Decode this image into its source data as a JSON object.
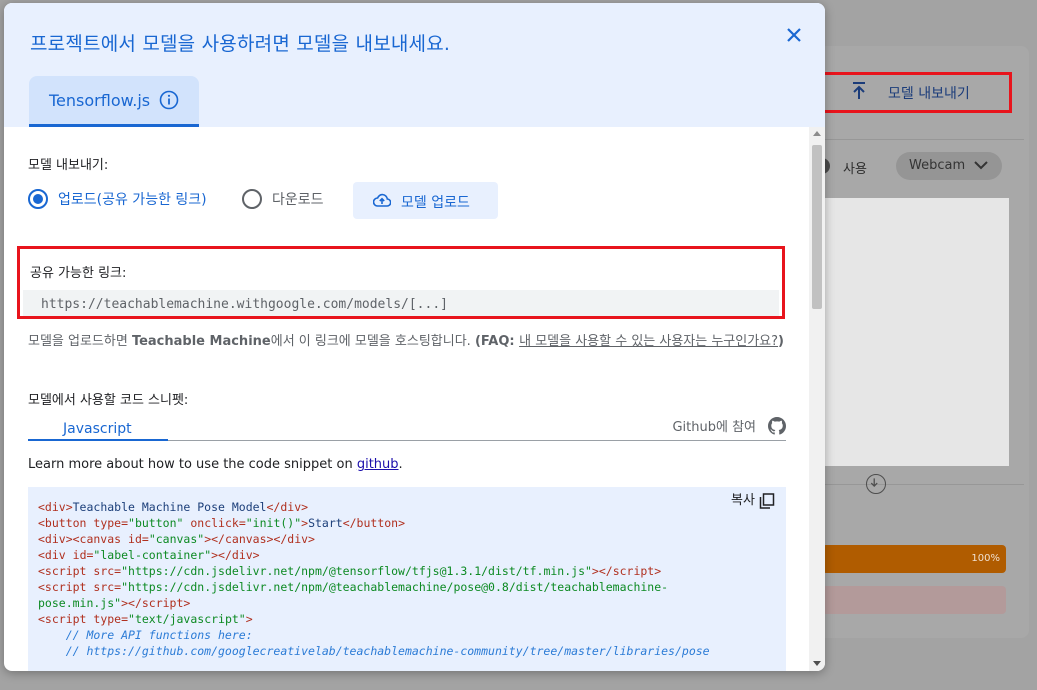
{
  "background": {
    "export_button_label": "모델 내보내기",
    "use_label": "사용",
    "webcam_label": "Webcam",
    "progress_pct": "100%"
  },
  "modal": {
    "title": "프로젝트에서 모델을 사용하려면 모델을 내보내세요.",
    "tab_label": "Tensorflow.js",
    "export_section_label": "모델 내보내기:",
    "radio_upload_label": "업로드(공유 가능한 링크)",
    "radio_download_label": "다운로드",
    "upload_button_label": "모델 업로드",
    "share_link_title": "공유 가능한 링크:",
    "share_link_url": "https://teachablemachine.withgoogle.com/models/[...]",
    "desc_part1": "모델을 업로드하면 ",
    "desc_bold1": "Teachable Machine",
    "desc_part2": "에서 이 링크에 모델을 호스팅합니다. ",
    "desc_bold2": "(FAQ: ",
    "desc_link": "내 모델을 사용할 수 있는 사용자는 누구인가요?",
    "desc_bold3": ")",
    "snippet_label": "모델에서 사용할 코드 스니펫:",
    "code_tab_label": "Javascript",
    "github_link_label": "Github에 참여",
    "learn_prefix": "Learn more about how to use the code snippet on ",
    "learn_link": "github",
    "learn_suffix": ".",
    "copy_label": "복사"
  }
}
